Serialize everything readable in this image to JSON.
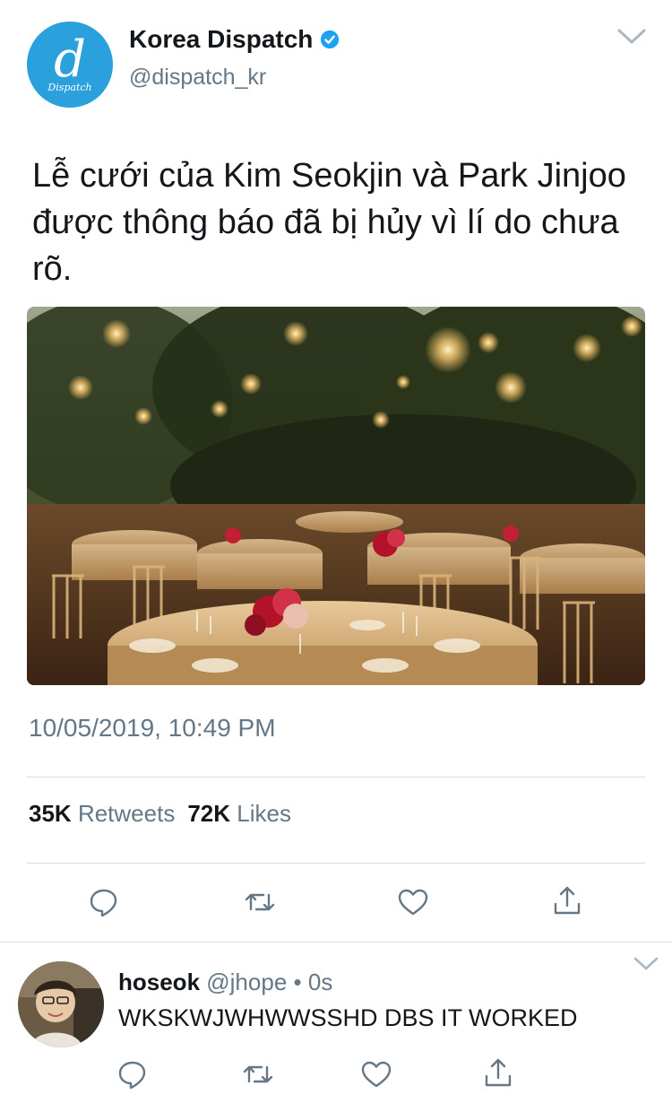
{
  "tweet": {
    "author": {
      "name": "Korea Dispatch",
      "handle": "@dispatch_kr",
      "avatar_letter": "d",
      "avatar_label": "Dispatch",
      "brand_color": "#2aa0dc"
    },
    "text": "Lễ cưới của Kim Seokjin và Park Jinjoo được thông báo đã bị hủy vì lí do chưa rõ.",
    "timestamp": "10/05/2019, 10:49 PM",
    "stats": {
      "retweets_count": "35K",
      "retweets_label": "Retweets",
      "likes_count": "72K",
      "likes_label": "Likes"
    },
    "actions": [
      "reply-icon",
      "retweet-icon",
      "like-icon",
      "share-icon"
    ]
  },
  "reply": {
    "name": "hoseok",
    "handle": "@jhope",
    "separator": "•",
    "time": "0s",
    "text": "WKSKWJWHWWSSHD DBS IT WORKED",
    "actions": [
      "reply-icon",
      "retweet-icon",
      "like-icon",
      "share-icon"
    ]
  },
  "colors": {
    "text_primary": "#14171a",
    "text_secondary": "#657786",
    "verified_blue": "#1da1f2",
    "divider": "#d8dee3"
  }
}
